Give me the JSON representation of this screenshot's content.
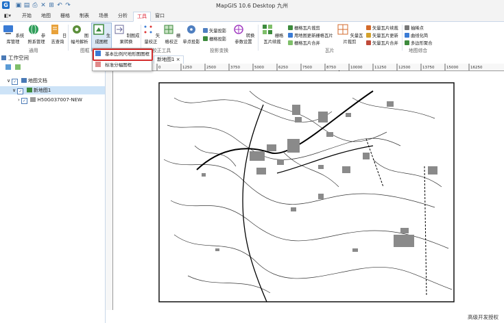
{
  "app": {
    "title": "MapGIS 10.6 Desktop 九州"
  },
  "menu_tabs": [
    "开始",
    "地图",
    "栅格",
    "制表",
    "场景",
    "分析",
    "工具",
    "窗口"
  ],
  "ribbon": {
    "system_mgmt": "系统库管理",
    "ref_mgmt": "参照系管理",
    "log_query": "日志查询",
    "sheet_parse": "图幅号解析",
    "gen_frame": "生成图框",
    "batch_conv": "制图成果转换",
    "vec_correct": "矢量校正",
    "raster_correct": "栅格校正",
    "single_proj": "单点投影",
    "vec_proj": "矢量投影",
    "raster_proj": "栅格投影",
    "param_set": "转换参数设置",
    "raster_tile_crop": "栅格瓦片裁剪",
    "use_map_update": "用地图更新栅格瓦片",
    "raster_tile_merge": "栅格瓦片合并",
    "raster_tile_continue": "栅格瓦片续裁",
    "vec_tile_crop": "矢量瓦片裁剪",
    "vec_tile_continue": "矢量瓦片续裁",
    "vec_tile_update": "矢量瓦片更新",
    "vec_tile_merge": "矢量瓦片合并",
    "thin_points": "抽稀点",
    "curve_smooth": "曲线化简",
    "polygon_merge": "多边形聚合",
    "groups": {
      "general": "通用",
      "frame": "图框",
      "correct": "校正工具",
      "proj": "投影变换",
      "tile": "瓦片",
      "map_general": "地图综合"
    }
  },
  "dropdown": {
    "item1": "基本比例尺地形图图框",
    "item2": "标准分幅图框"
  },
  "workspace": {
    "title": "工作空间",
    "tree": {
      "doc": "地图文档",
      "map": "新地图1",
      "layer": "H50G037007-NEW"
    }
  },
  "map_tab": {
    "label": "新地图1",
    "close": "×"
  },
  "ruler_labels": [
    "0",
    "1250",
    "2500",
    "3750",
    "5000",
    "6250",
    "7500",
    "8750",
    "10000",
    "11250",
    "12500",
    "13750",
    "15000",
    "16250"
  ],
  "status": {
    "license": "高级开发授权"
  },
  "colors": {
    "accent": "#d32b2b",
    "selection": "#cde3f7",
    "ribbon_border": "#c9d7e8"
  }
}
